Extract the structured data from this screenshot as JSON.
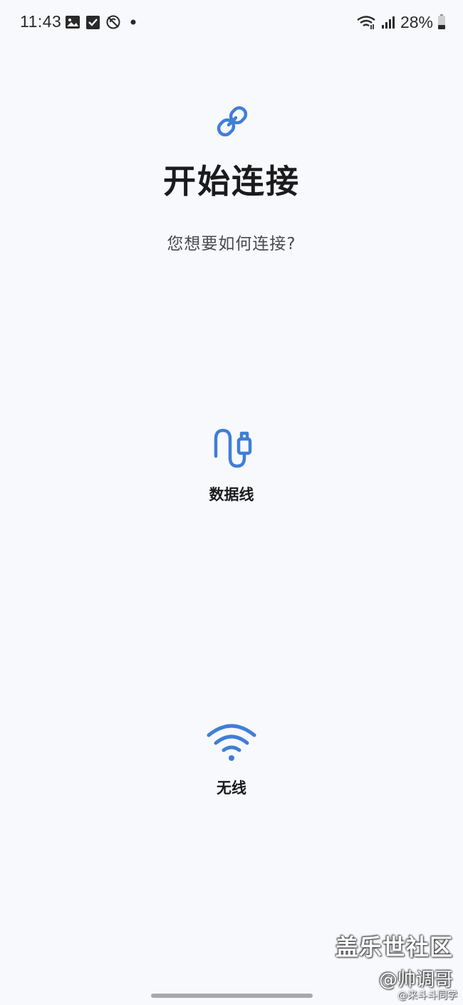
{
  "status_bar": {
    "time": "11:43",
    "battery": "28%",
    "icons": [
      "image-icon",
      "checkbox-icon",
      "no-sync-icon",
      "dot-icon",
      "wifi-icon",
      "signal-icon",
      "battery-icon"
    ]
  },
  "header": {
    "icon": "link-icon",
    "title": "开始连接",
    "subtitle": "您想要如何连接?"
  },
  "options": [
    {
      "icon": "usb-cable-icon",
      "label": "数据线"
    },
    {
      "icon": "wifi-icon",
      "label": "无线"
    }
  ],
  "watermark": {
    "line1": "盖乐世社区",
    "line2": "@帅调哥",
    "line3": "@来斗斗同学"
  },
  "colors": {
    "accent": "#3f7ed8",
    "background": "#f8f9fd",
    "text": "#1b1b1d"
  }
}
